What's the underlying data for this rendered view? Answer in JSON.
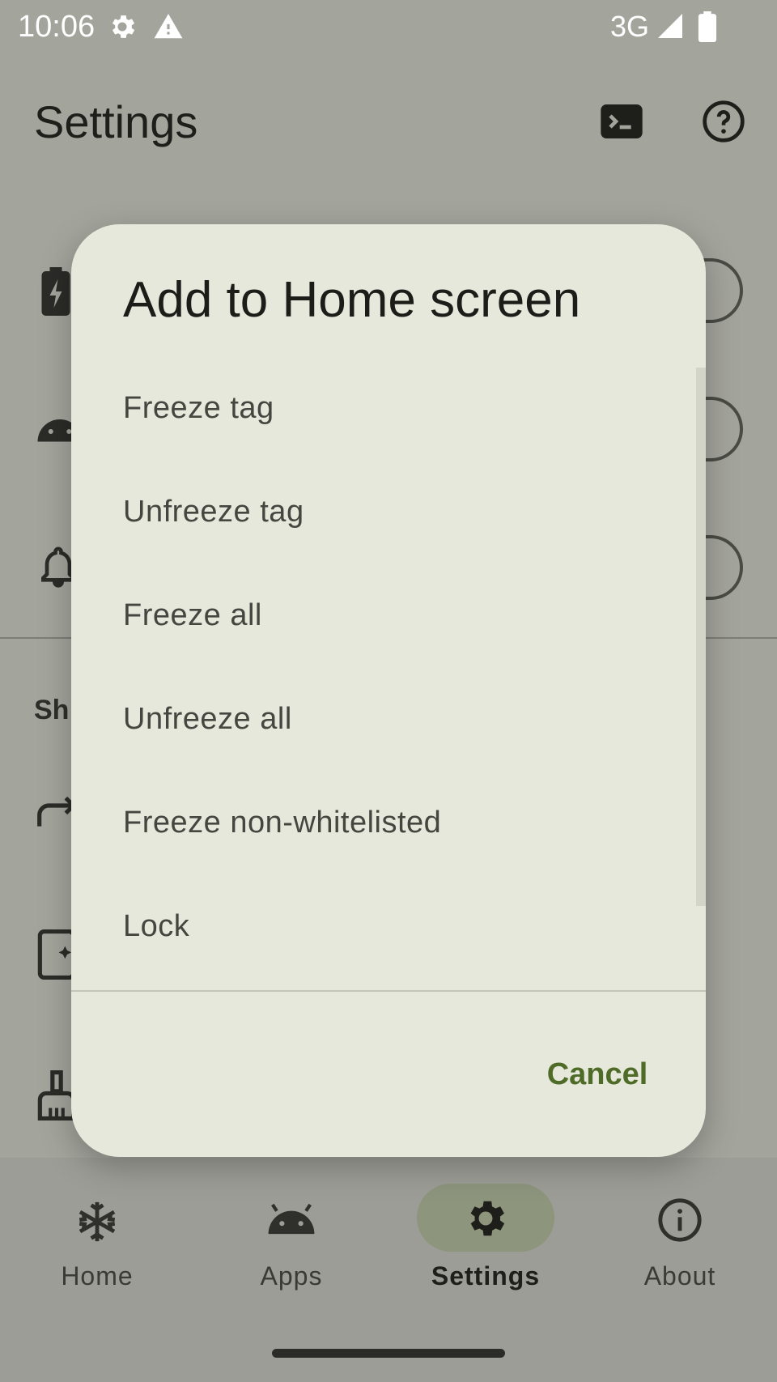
{
  "status_bar": {
    "time": "10:06",
    "network": "3G",
    "icons": [
      "gear-icon",
      "warning-icon",
      "signal-icon",
      "battery-icon"
    ]
  },
  "app_bar": {
    "title": "Settings",
    "icons": [
      "terminal-icon",
      "help-icon"
    ]
  },
  "background": {
    "section_label": "Sh",
    "row_icons": [
      "battery-bolt-icon",
      "android-icon",
      "alarm-icon",
      "share-icon",
      "book-icon",
      "broom-icon"
    ]
  },
  "dialog": {
    "title": "Add to Home screen",
    "items": [
      {
        "label": "Freeze tag"
      },
      {
        "label": "Unfreeze tag"
      },
      {
        "label": "Freeze all"
      },
      {
        "label": "Unfreeze all"
      },
      {
        "label": "Freeze non-whitelisted"
      },
      {
        "label": "Lock"
      }
    ],
    "cancel_label": "Cancel"
  },
  "nav": {
    "items": [
      {
        "label": "Home",
        "icon": "snowflake-icon"
      },
      {
        "label": "Apps",
        "icon": "android-icon"
      },
      {
        "label": "Settings",
        "icon": "gear-icon",
        "active": true
      },
      {
        "label": "About",
        "icon": "info-icon"
      }
    ]
  },
  "colors": {
    "scrim": "#a3a49c",
    "dialog_bg": "#e6e8dc",
    "accent": "#4f6b28",
    "active_pill": "#8d957d"
  }
}
